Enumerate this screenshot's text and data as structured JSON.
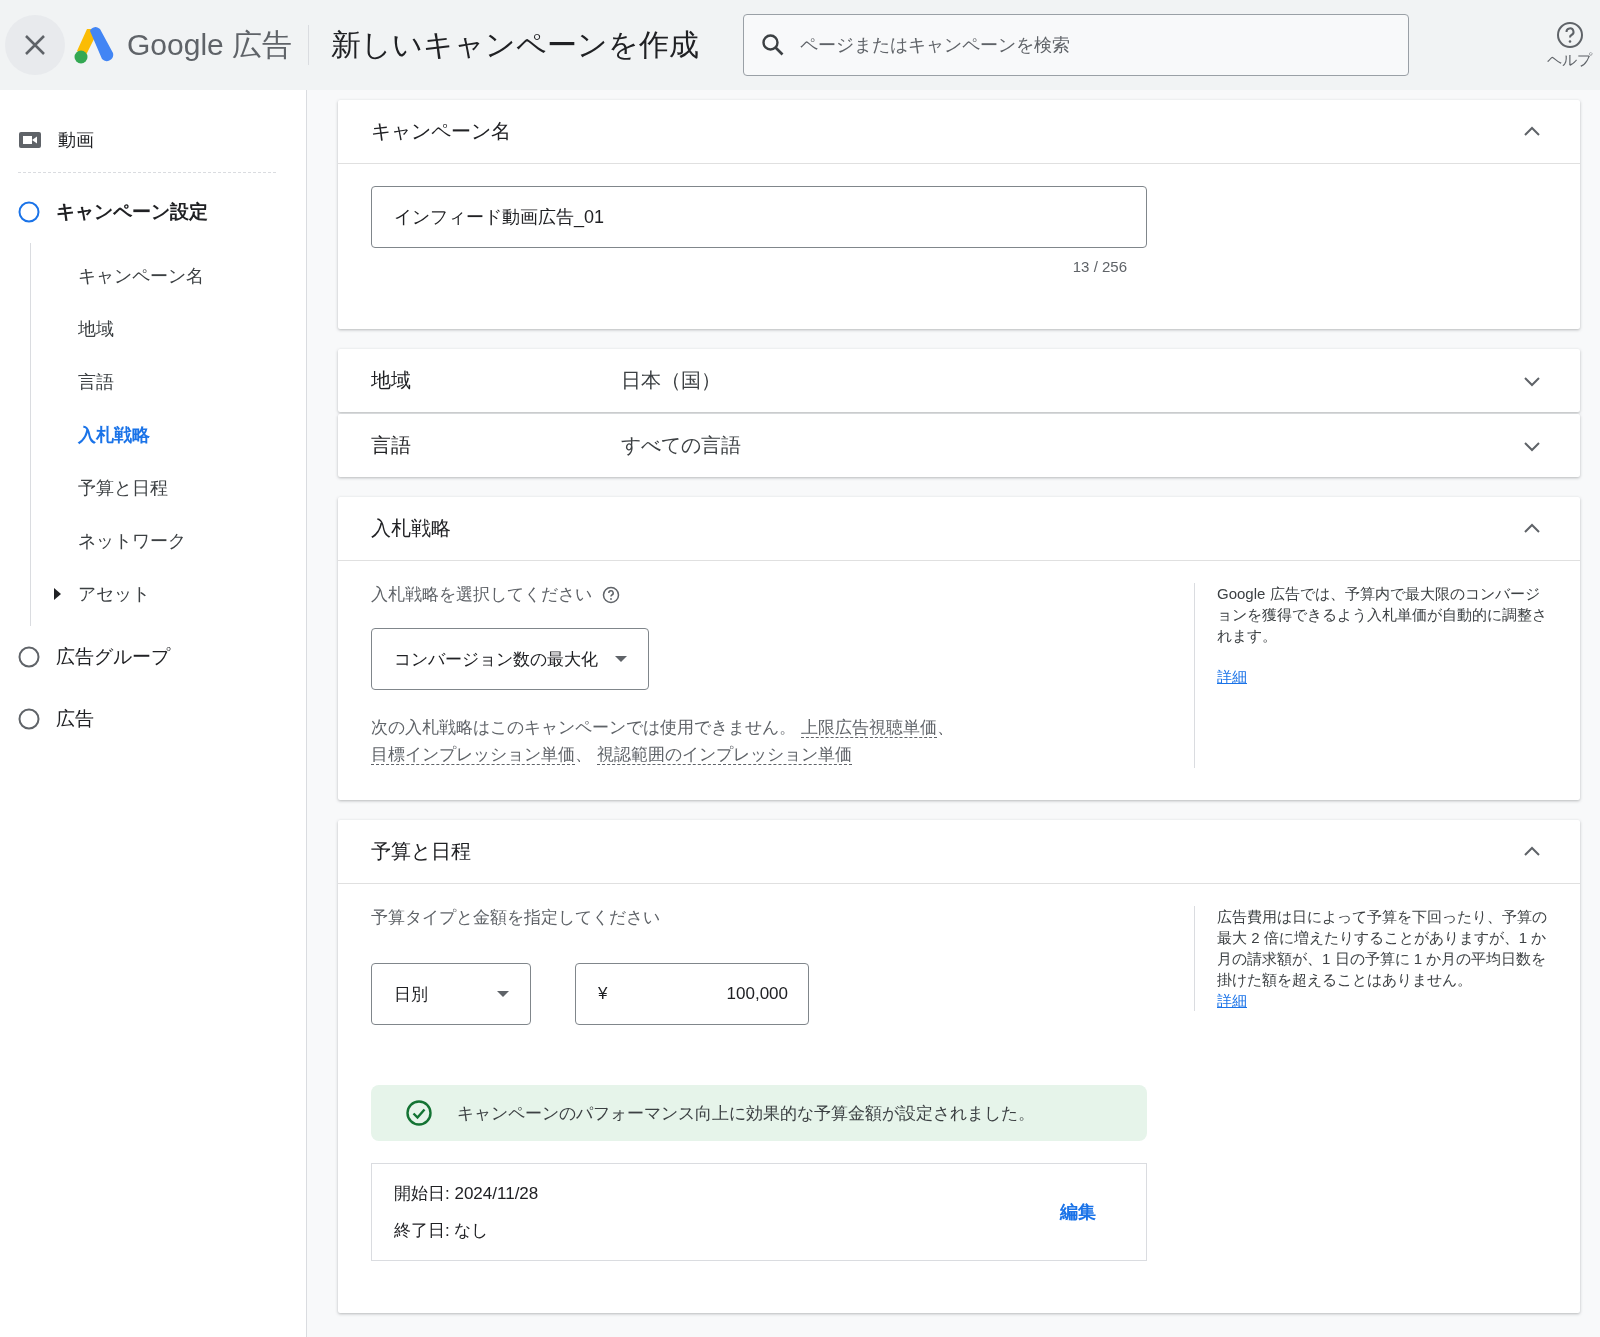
{
  "header": {
    "product": "Google 広告",
    "title": "新しいキャンペーンを作成",
    "search": {
      "placeholder": "ページまたはキャンペーンを検索"
    },
    "help_label": "ヘルプ"
  },
  "sidebar": {
    "section": "動画",
    "steps": [
      {
        "label": "キャンペーン設定",
        "selected": true,
        "children": [
          {
            "label": "キャンペーン名",
            "selected": false
          },
          {
            "label": "地域",
            "selected": false
          },
          {
            "label": "言語",
            "selected": false
          },
          {
            "label": "入札戦略",
            "selected": true
          },
          {
            "label": "予算と日程",
            "selected": false
          },
          {
            "label": "ネットワーク",
            "selected": false
          },
          {
            "label": "アセット",
            "selected": false,
            "expanded": false
          }
        ]
      },
      {
        "label": "広告グループ",
        "selected": false
      },
      {
        "label": "広告",
        "selected": false
      }
    ]
  },
  "cards": [
    {
      "kind": "name",
      "title": "キャンペーン名",
      "expanded": true,
      "value": "インフィード動画広告_01",
      "counter": "13 / 256"
    },
    {
      "kind": "summary",
      "title": "地域",
      "expanded": false,
      "summary": "日本（国）"
    },
    {
      "kind": "summary",
      "title": "言語",
      "expanded": false,
      "summary": "すべての言語"
    },
    {
      "kind": "bidding",
      "title": "入札戦略",
      "expanded": true,
      "prompt": "入札戦略を選択してください",
      "strategy": "コンバージョン数の最大化",
      "note": "次の入札戦略はこのキャンペーンでは使用できません。",
      "unavailable": [
        "上限広告視聴単価",
        "目標インプレッション単価",
        "視認範囲のインプレッション単価"
      ],
      "separator": "、",
      "help": "Google 広告では、予算内で最大限のコンバージョンを獲得できるよう入札単価が自動的に調整されます。",
      "help_link": "詳細"
    },
    {
      "kind": "budget",
      "title": "予算と日程",
      "expanded": true,
      "prompt": "予算タイプと金額を指定してください",
      "budget_type": "日別",
      "currency": "¥",
      "amount": "100,000",
      "help": "広告費用は日によって予算を下回ったり、予算の最大 2 倍に増えたりすることがありますが、1 か月の請求額が、1 日の予算に 1 か月の平均日数を掛けた額を超えることはありません。",
      "help_link": "詳細",
      "success": "キャンペーンのパフォーマンス向上に効果的な予算金額が設定されました。",
      "start": "開始日: 2024/11/28",
      "end": "終了日: なし",
      "edit": "編集"
    }
  ]
}
